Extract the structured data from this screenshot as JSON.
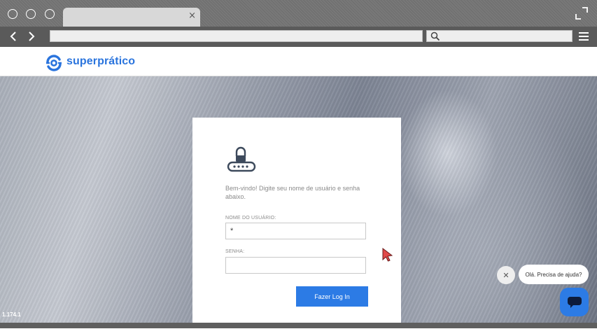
{
  "browser": {
    "tab_close": "×"
  },
  "header": {
    "logo_text": "superprático"
  },
  "login": {
    "welcome": "Bem-vindo! Digite seu nome de usuário e senha abaixo.",
    "username_label": "NOME DO USUÁRIO:",
    "username_value": "*",
    "password_label": "SENHA:",
    "password_value": "",
    "submit_label": "Fazer Log In"
  },
  "footer": {
    "version": "1.174.1"
  },
  "chat": {
    "close_label": "✕",
    "prompt": "Olá. Precisa de ajuda?"
  },
  "colors": {
    "brand_blue": "#2a74dd",
    "button_blue": "#2c7be5"
  },
  "icons": [
    "maximize-icon",
    "back-arrow-icon",
    "forward-arrow-icon",
    "search-icon",
    "menu-icon",
    "logo-mark-icon",
    "lock-icon",
    "cursor-icon",
    "close-icon",
    "chat-icon"
  ]
}
